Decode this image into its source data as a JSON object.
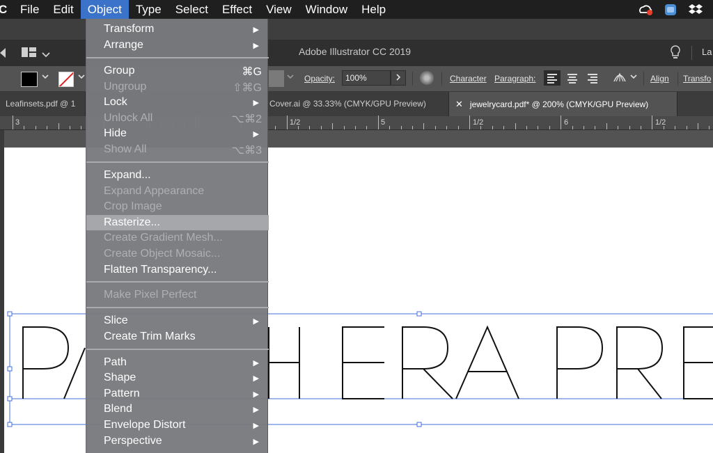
{
  "menubar": {
    "app_glyph": "C",
    "items": [
      {
        "label": "File"
      },
      {
        "label": "Edit"
      },
      {
        "label": "Object"
      },
      {
        "label": "Type"
      },
      {
        "label": "Select"
      },
      {
        "label": "Effect"
      },
      {
        "label": "View"
      },
      {
        "label": "Window"
      },
      {
        "label": "Help"
      }
    ],
    "tray_icons": [
      "creative-cloud-icon",
      "app-badge-icon",
      "dropbox-icon"
    ]
  },
  "app": {
    "title": "Adobe Illustrator CC 2019",
    "right_edge_text": "La"
  },
  "control_bar": {
    "opacity_label": "Opacity:",
    "opacity_value": "100%",
    "character_label": "Character",
    "paragraph_label": "Paragraph:",
    "align_label": "Align",
    "transform_label": "Transfo"
  },
  "tabs": [
    {
      "label": "Leafinsets.pdf @ 1"
    },
    {
      "label": "Cover.ai @ 33.33% (CMYK/GPU Preview)"
    },
    {
      "label": "jewelrycard.pdf* @ 200% (CMYK/GPU Preview)",
      "close": "✕"
    }
  ],
  "ruler": {
    "labels": [
      "3",
      "1/2",
      "5",
      "1/2",
      "6",
      "1/2"
    ]
  },
  "artwork": {
    "text": "PANTHERA PRE",
    "selection_color": "#3f6fd8"
  },
  "object_menu": {
    "items": [
      {
        "label": "Transform",
        "shortcut": "",
        "submenu": true,
        "disabled": false
      },
      {
        "label": "Arrange",
        "shortcut": "",
        "submenu": true,
        "disabled": false
      },
      {
        "label": "Group",
        "shortcut": "⌘G",
        "submenu": false,
        "disabled": false
      },
      {
        "label": "Ungroup",
        "shortcut": "⇧⌘G",
        "submenu": false,
        "disabled": true
      },
      {
        "label": "Lock",
        "shortcut": "",
        "submenu": true,
        "disabled": false
      },
      {
        "label": "Unlock All",
        "shortcut": "⌥⌘2",
        "submenu": false,
        "disabled": true
      },
      {
        "label": "Hide",
        "shortcut": "",
        "submenu": true,
        "disabled": false
      },
      {
        "label": "Show All",
        "shortcut": "⌥⌘3",
        "submenu": false,
        "disabled": true
      },
      {
        "label": "Expand...",
        "shortcut": "",
        "submenu": false,
        "disabled": false
      },
      {
        "label": "Expand Appearance",
        "shortcut": "",
        "submenu": false,
        "disabled": true
      },
      {
        "label": "Crop Image",
        "shortcut": "",
        "submenu": false,
        "disabled": true
      },
      {
        "label": "Rasterize...",
        "shortcut": "",
        "submenu": false,
        "disabled": false,
        "highlighted": true
      },
      {
        "label": "Create Gradient Mesh...",
        "shortcut": "",
        "submenu": false,
        "disabled": true
      },
      {
        "label": "Create Object Mosaic...",
        "shortcut": "",
        "submenu": false,
        "disabled": true
      },
      {
        "label": "Flatten Transparency...",
        "shortcut": "",
        "submenu": false,
        "disabled": false
      },
      {
        "label": "Make Pixel Perfect",
        "shortcut": "",
        "submenu": false,
        "disabled": true
      },
      {
        "label": "Slice",
        "shortcut": "",
        "submenu": true,
        "disabled": false
      },
      {
        "label": "Create Trim Marks",
        "shortcut": "",
        "submenu": false,
        "disabled": false
      },
      {
        "label": "Path",
        "shortcut": "",
        "submenu": true,
        "disabled": false
      },
      {
        "label": "Shape",
        "shortcut": "",
        "submenu": true,
        "disabled": false
      },
      {
        "label": "Pattern",
        "shortcut": "",
        "submenu": true,
        "disabled": false
      },
      {
        "label": "Blend",
        "shortcut": "",
        "submenu": true,
        "disabled": false
      },
      {
        "label": "Envelope Distort",
        "shortcut": "",
        "submenu": true,
        "disabled": false
      },
      {
        "label": "Perspective",
        "shortcut": "",
        "submenu": true,
        "disabled": false
      }
    ],
    "submenu_arrow": "▶"
  },
  "colors": {
    "menu_active": "#3a73c9",
    "menu_bg": "#787a7d",
    "menu_highlight": "#a5a7aa"
  }
}
